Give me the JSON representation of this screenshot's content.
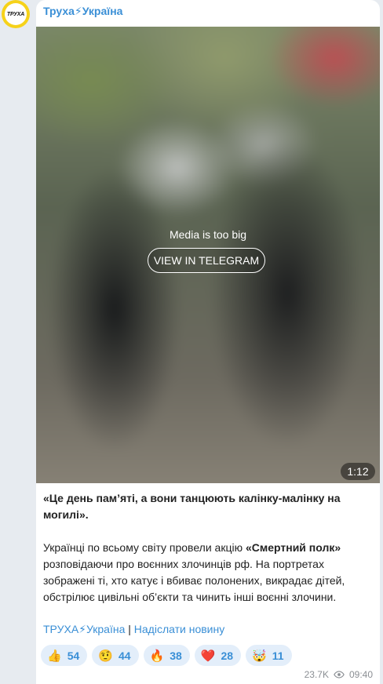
{
  "channel": {
    "avatar_text": "ТРУХА",
    "name": "Труха⚡Україна"
  },
  "media": {
    "message": "Media is too big",
    "button_label": "VIEW IN TELEGRAM",
    "duration": "1:12"
  },
  "post": {
    "quote": "«Це день пам’яті, а вони танцюють калінку-малінку на могилі».",
    "body_before": "Українці по всьому світу провели акцію ",
    "body_bold": "«Смертний полк»",
    "body_after": " розповідаючи про воєнних злочинців рф. На портретах зображені ті, хто катує і вбиває полонених, викрадає дітей, обстрілює цивільні об’єкти та чинить інші воєнні злочини."
  },
  "links": {
    "channel_link": "ТРУХА⚡Україна",
    "separator": " | ",
    "submit_link": "Надіслати новину"
  },
  "reactions": [
    {
      "emoji": "👍",
      "icon": "thumbs-up-icon",
      "count": "54"
    },
    {
      "emoji": "🤨",
      "icon": "raised-eyebrow-icon",
      "count": "44"
    },
    {
      "emoji": "🔥",
      "icon": "fire-icon",
      "count": "38"
    },
    {
      "emoji": "❤️",
      "icon": "heart-icon",
      "count": "28"
    },
    {
      "emoji": "🤯",
      "icon": "exploding-head-icon",
      "count": "11"
    }
  ],
  "meta": {
    "views": "23.7K",
    "time": "09:40"
  },
  "colors": {
    "accent": "#3a8fd6",
    "avatar_ring": "#f6d21a",
    "reaction_bg": "#e3eefa"
  }
}
